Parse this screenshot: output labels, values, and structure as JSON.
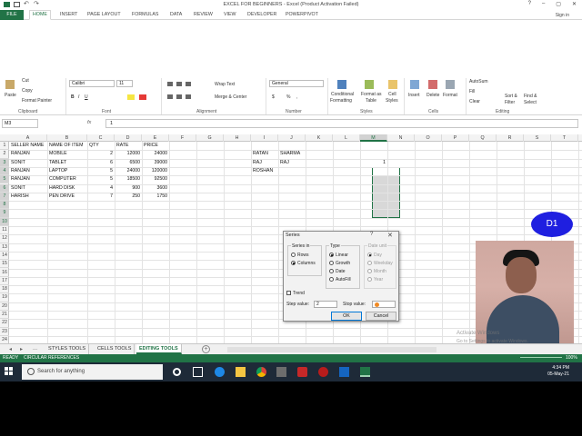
{
  "titlebar": {
    "title": "EXCEL FOR BEGINNERS - Excel (Product Activation Failed)",
    "help": "?",
    "min": "–",
    "restore": "▢",
    "close": "✕"
  },
  "ribbon_tabs": [
    "FILE",
    "HOME",
    "INSERT",
    "PAGE LAYOUT",
    "FORMULAS",
    "DATA",
    "REVIEW",
    "VIEW",
    "DEVELOPER",
    "POWERPIVOT"
  ],
  "sign_in": "Sign in",
  "ribbon": {
    "clipboard": {
      "paste": "Paste",
      "cut": "Cut",
      "copy": "Copy",
      "format_painter": "Format Painter",
      "label": "Clipboard"
    },
    "font": {
      "name": "Calibri",
      "size": "11",
      "bold": "B",
      "italic": "I",
      "underline": "U",
      "label": "Font"
    },
    "alignment": {
      "wrap": "Wrap Text",
      "merge": "Merge & Center",
      "label": "Alignment"
    },
    "number": {
      "format": "General",
      "currency": "$",
      "percent": "%",
      "comma": ",",
      "label": "Number"
    },
    "styles": {
      "conditional": "Conditional",
      "conditional2": "Formatting",
      "format_as": "Format as",
      "format_as2": "Table",
      "cell": "Cell",
      "cell2": "Styles",
      "label": "Styles"
    },
    "cells": {
      "insert": "Insert",
      "delete": "Delete",
      "format": "Format",
      "label": "Cells"
    },
    "editing": {
      "autosum": "AutoSum",
      "fill": "Fill",
      "clear": "Clear",
      "sort": "Sort &",
      "sort2": "Filter",
      "find": "Find &",
      "find2": "Select",
      "label": "Editing"
    }
  },
  "formula_bar": {
    "name_box": "M3",
    "fx": "fx",
    "value": "1"
  },
  "columns": [
    "A",
    "B",
    "C",
    "D",
    "E",
    "F",
    "G",
    "H",
    "I",
    "J",
    "K",
    "L",
    "M",
    "N",
    "O",
    "P",
    "Q",
    "R",
    "S",
    "T"
  ],
  "rows": [
    "1",
    "2",
    "3",
    "4",
    "5",
    "6",
    "7",
    "8",
    "9",
    "10",
    "11",
    "12",
    "13",
    "14",
    "15",
    "16",
    "17",
    "18",
    "19",
    "20",
    "21",
    "22",
    "23",
    "24"
  ],
  "table": {
    "headers": [
      "SELLER NAME",
      "NAME OF ITEM",
      "QTY",
      "RATE",
      "PRICE"
    ],
    "rows": [
      [
        "RANJAN",
        "MOBILE",
        "2",
        "12000",
        "24000"
      ],
      [
        "SONIT",
        "TABLET",
        "6",
        "6500",
        "39000"
      ],
      [
        "RANJAN",
        "LAPTOP",
        "5",
        "24000",
        "120000"
      ],
      [
        "RANJAN",
        "COMPUTER",
        "5",
        "18500",
        "92500"
      ],
      [
        "SONIT",
        "HARD DISK",
        "4",
        "900",
        "3600"
      ],
      [
        "HARISH",
        "PEN DRIVE",
        "7",
        "250",
        "1750"
      ]
    ]
  },
  "names": {
    "i2": "RATAN",
    "j2": "SHARMA",
    "i3": "RAJ",
    "j3": "RAJ",
    "i4": "ROSHAN"
  },
  "selected_value": "1",
  "sheets": {
    "nav_more": "...",
    "tabs": [
      "STYLES TOOLS",
      "CELLS TOOLS",
      "EDITING TOOLS"
    ],
    "active": "EDITING TOOLS",
    "add": "+"
  },
  "status": {
    "ready": "READY",
    "circular": "CIRCULAR REFERENCES",
    "zoom": "100%"
  },
  "taskbar": {
    "search": "Search for anything",
    "time": "4:34 PM",
    "date": "05-May-21"
  },
  "dialog": {
    "title": "Series",
    "help": "?",
    "close": "✕",
    "series_in": "Series in",
    "rows": "Rows",
    "columns": "Columns",
    "type": "Type",
    "linear": "Linear",
    "growth": "Growth",
    "date": "Date",
    "autofill": "AutoFill",
    "date_unit": "Date unit",
    "day": "Day",
    "weekday": "Weekday",
    "month": "Month",
    "year": "Year",
    "trend": "Trend",
    "step_label": "Step value:",
    "step_value": "2",
    "stop_label": "Stop value:",
    "ok": "OK",
    "cancel": "Cancel"
  },
  "overlay": {
    "badge": "D1",
    "watermark1": "Activate Windows",
    "watermark2": "Go to Settings to activate Windows."
  },
  "colors": {
    "excel_green": "#217346",
    "taskbar": "#1e2a38",
    "badge": "#1f1fe0"
  }
}
